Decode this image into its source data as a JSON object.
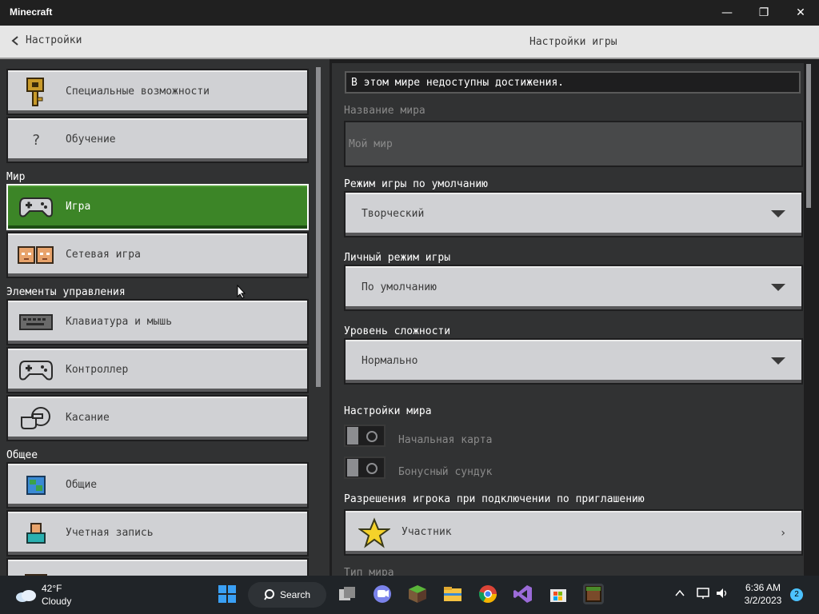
{
  "window": {
    "title": "Minecraft",
    "min_glyph": "—",
    "restore_glyph": "❐",
    "close_glyph": "✕"
  },
  "header": {
    "back_label": "Настройки",
    "title": "Настройки игры"
  },
  "sidebar": {
    "items": [
      {
        "label": "Специальные возможности",
        "icon": "key-icon"
      },
      {
        "label": "Обучение",
        "icon": "question-icon",
        "glyph": "?"
      },
      {
        "label": "Игра",
        "icon": "controller-icon"
      },
      {
        "label": "Сетевая игра",
        "icon": "multiplayer-faces-icon"
      },
      {
        "label": "Клавиатура и мышь",
        "icon": "keyboard-icon"
      },
      {
        "label": "Контроллер",
        "icon": "controller-icon"
      },
      {
        "label": "Касание",
        "icon": "touch-hand-icon"
      },
      {
        "label": "Общие",
        "icon": "globe-icon"
      },
      {
        "label": "Учетная запись",
        "icon": "account-icon"
      }
    ],
    "sections": {
      "world": "Мир",
      "controls": "Элементы управления",
      "general": "Общее"
    },
    "active_color": "#3c8527"
  },
  "main": {
    "notice": "В этом мире недоступны достижения.",
    "world_name_label": "Название мира",
    "world_name_value": "Мой мир",
    "default_mode_label": "Режим игры по умолчанию",
    "default_mode_value": "Творческий",
    "personal_mode_label": "Личный режим игры",
    "personal_mode_value": "По умолчанию",
    "difficulty_label": "Уровень сложности",
    "difficulty_value": "Нормально",
    "world_settings_label": "Настройки мира",
    "starting_map_label": "Начальная карта",
    "bonus_chest_label": "Бонусный сундук",
    "permissions_label": "Разрешения игрока при подключении по приглашению",
    "permissions_value": "Участник",
    "world_type_label": "Тип мира"
  },
  "taskbar": {
    "weather_temp": "42°F",
    "weather_cond": "Cloudy",
    "search_label": "Search",
    "time": "6:36 AM",
    "date": "3/2/2023",
    "notifications": "2"
  }
}
